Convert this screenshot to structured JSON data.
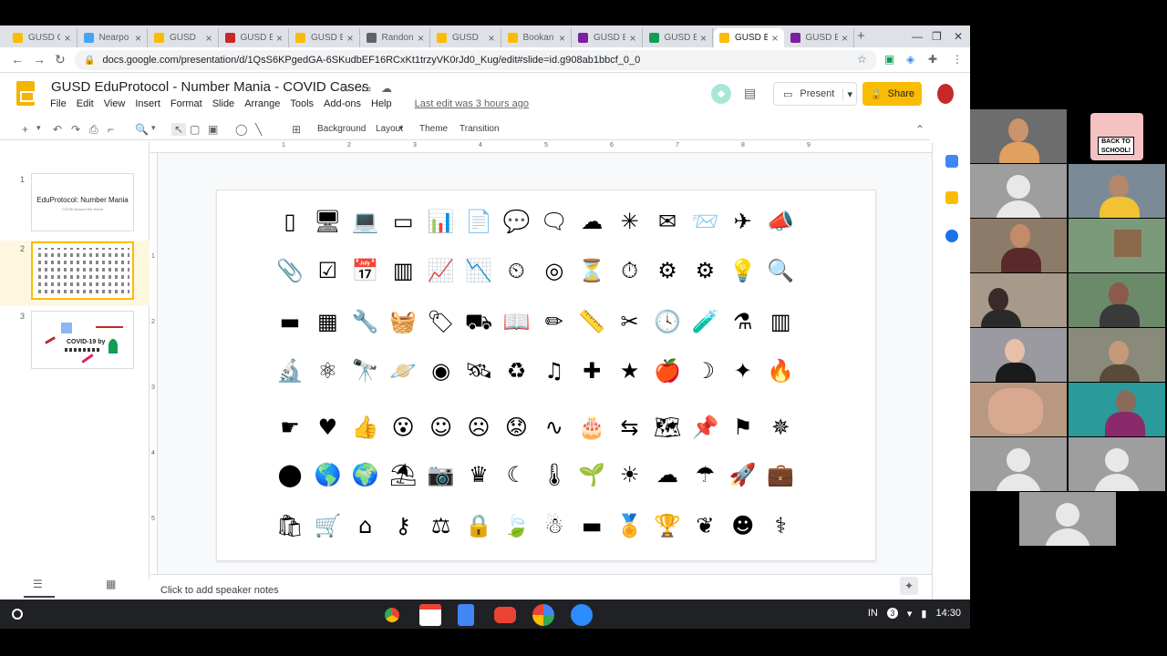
{
  "browser": {
    "tabs": [
      {
        "label": "GUSD G",
        "color": "#fbbc04"
      },
      {
        "label": "Nearpo",
        "color": "#42a5f5"
      },
      {
        "label": "GUSD",
        "color": "#fbbc04"
      },
      {
        "label": "GUSD E",
        "color": "#c62828"
      },
      {
        "label": "GUSD E",
        "color": "#fbbc04"
      },
      {
        "label": "Randon",
        "color": "#5f6368"
      },
      {
        "label": "GUSD",
        "color": "#fbbc04"
      },
      {
        "label": "Bookan",
        "color": "#fbbc04"
      },
      {
        "label": "GUSD E",
        "color": "#7b1fa2"
      },
      {
        "label": "GUSD E",
        "color": "#0f9d58"
      },
      {
        "label": "GUSD E",
        "color": "#fbbc04"
      },
      {
        "label": "GUSD E",
        "color": "#7b1fa2"
      }
    ],
    "active_tab_index": 10,
    "url": "docs.google.com/presentation/d/1QsS6KPgedGA-6SKudbEF16RCxKt1trzyVK0rJd0_Kug/edit#slide=id.g908ab1bbcf_0_0"
  },
  "doc": {
    "title": "GUSD EduProtocol - Number Mania - COVID Cases",
    "menus": [
      "File",
      "Edit",
      "View",
      "Insert",
      "Format",
      "Slide",
      "Arrange",
      "Tools",
      "Add-ons",
      "Help"
    ],
    "last_edit": "Last edit was 3 hours ago",
    "present_label": "Present",
    "share_label": "Share"
  },
  "toolbar": {
    "background_label": "Background",
    "layout_label": "Layout",
    "theme_label": "Theme",
    "transition_label": "Transition"
  },
  "ruler": [
    "1",
    "2",
    "3",
    "4",
    "5",
    "6",
    "7",
    "8",
    "9"
  ],
  "vruler": [
    "1",
    "2",
    "3",
    "4",
    "5"
  ],
  "filmstrip": {
    "slides": [
      {
        "number": "1",
        "title": "EduProtocol: Number Mania",
        "subtitle": "COVID Around the World"
      },
      {
        "number": "2"
      },
      {
        "number": "3",
        "title": "COVID-19 by"
      }
    ],
    "selected_index": 1
  },
  "slide_icons": [
    [
      "smartphone-icon",
      "monitor-icon",
      "laptop-icon",
      "tablet-icon",
      "presentation-icon",
      "document-icon",
      "speech-bubble-icon",
      "chat-bubbles-icon",
      "cloud-icon",
      "network-icon",
      "envelope-icon",
      "letter-icon",
      "paper-plane-icon",
      "megaphone-icon"
    ],
    [
      "paperclip-icon",
      "checklist-icon",
      "calendar-icon",
      "bar-chart-icon",
      "line-chart-icon",
      "area-chart-icon",
      "speedometer-icon",
      "target-icon",
      "hourglass-icon",
      "stopwatch-icon",
      "gear-icon",
      "gears-icon",
      "lightbulb-icon",
      "magnifier-icon"
    ],
    [
      "credit-card-icon",
      "calculator-icon",
      "wrench-icon",
      "basket-icon",
      "tag-icon",
      "hand-truck-icon",
      "open-book-icon",
      "pencil-icon",
      "ruler-icon",
      "scissors-icon",
      "clock-icon",
      "test-tube-icon",
      "flask-icon",
      "test-tubes-icon"
    ],
    [
      "microscope-icon",
      "atom-icon",
      "telescope-icon",
      "planet-icon",
      "galaxy-icon",
      "satellite-icon",
      "recycle-bin-icon",
      "music-note-icon",
      "puzzle-icon",
      "star-icon",
      "apple-icon",
      "moon-icon",
      "stars-icon",
      "flame-icon"
    ],
    [
      "pointing-hand-icon",
      "heart-icon",
      "thumbs-up-icon",
      "shocked-face-icon",
      "smile-face-icon",
      "sad-face-icon",
      "worried-face-icon",
      "heartbeat-icon",
      "birthday-cake-icon",
      "signpost-icon",
      "map-icon",
      "pushpin-icon",
      "flag-icon",
      "compass-icon"
    ],
    [
      "location-pin-icon",
      "globe-americas-icon",
      "globe-icon",
      "beach-umbrella-icon",
      "camera-icon",
      "crown-icon",
      "night-icon",
      "thermometer-icon",
      "seedling-icon",
      "sun-icon",
      "cloud-solid-icon",
      "umbrella-icon",
      "rocket-icon",
      "briefcase-icon"
    ],
    [
      "shopping-bag-icon",
      "shopping-cart-icon",
      "house-icon",
      "key-icon",
      "scales-icon",
      "padlock-icon",
      "leaf-icon",
      "snowman-icon",
      "sunglasses-icon",
      "medal-icon",
      "trophy-icon",
      "brain-icon",
      "head-brain-icon",
      "stethoscope-icon"
    ]
  ],
  "slide_glyphs": [
    [
      "▯",
      "🖥",
      "💻",
      "▭",
      "📊",
      "📄",
      "💬",
      "🗨",
      "☁",
      "✳",
      "✉",
      "📨",
      "✈",
      "📣"
    ],
    [
      "📎",
      "☑",
      "📅",
      "▥",
      "📈",
      "📉",
      "⏲",
      "◎",
      "⏳",
      "⏱",
      "⚙",
      "⚙",
      "💡",
      "🔍"
    ],
    [
      "▬",
      "▦",
      "🔧",
      "🧺",
      "🏷",
      "⛟",
      "📖",
      "✏",
      "📏",
      "✂",
      "🕓",
      "🧪",
      "⚗",
      "▥"
    ],
    [
      "🔬",
      "⚛",
      "🔭",
      "🪐",
      "◉",
      "🛰",
      "♻",
      "♫",
      "✚",
      "★",
      "🍎",
      "☽",
      "✦",
      "🔥"
    ],
    [
      "☛",
      "♥",
      "👍",
      "😮",
      "☺",
      "☹",
      "😟",
      "∿",
      "🎂",
      "⇆",
      "🗺",
      "📌",
      "⚑",
      "✵"
    ],
    [
      "⬤",
      "🌎",
      "🌍",
      "⛱",
      "📷",
      "♛",
      "☾",
      "🌡",
      "🌱",
      "☀",
      "☁",
      "☂",
      "🚀",
      "💼"
    ]
  ],
  "notes": {
    "placeholder": "Click to add speaker notes"
  },
  "taskbar": {
    "input_method": "IN",
    "notification_count": "3",
    "time": "14:30"
  }
}
